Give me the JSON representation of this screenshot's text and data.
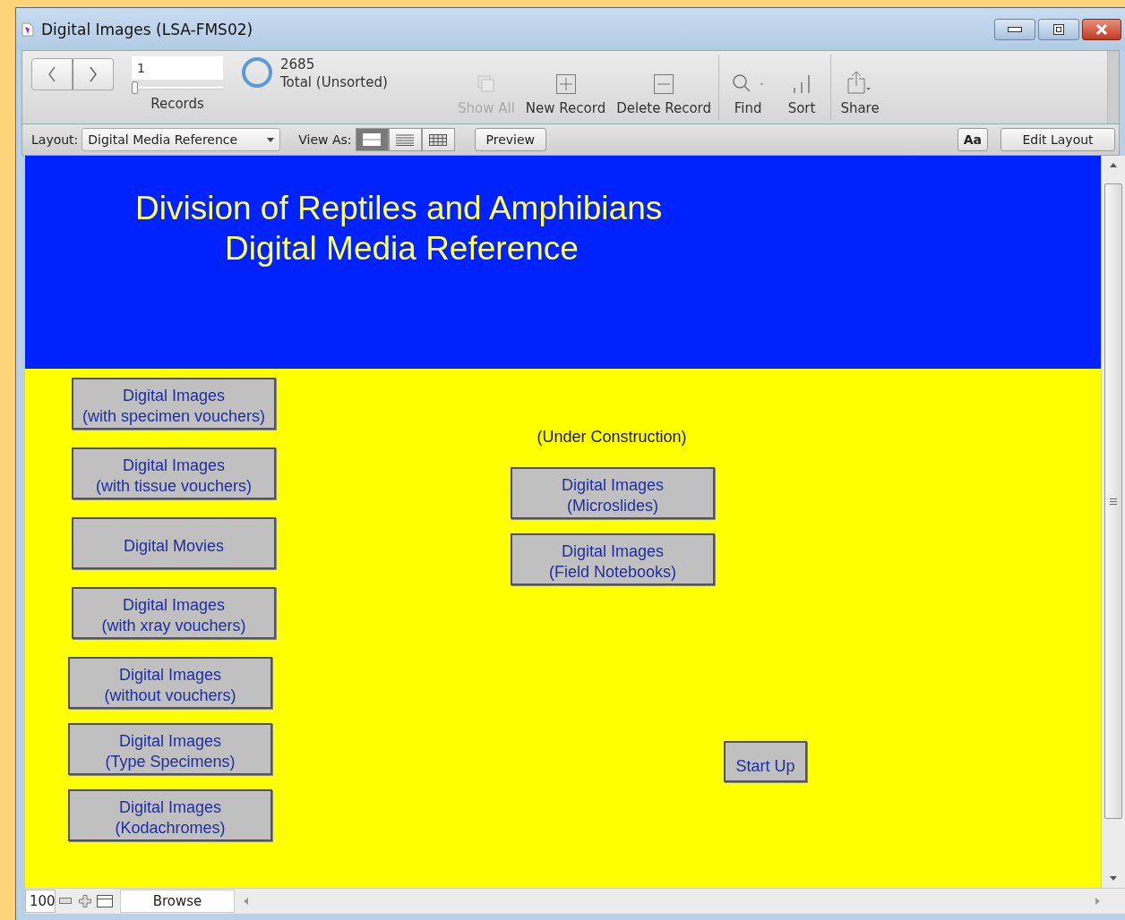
{
  "window": {
    "title": "Digital Images (LSA-FMS02)"
  },
  "toolbar": {
    "record_field": {
      "value": "1"
    },
    "record_slider": {
      "level": 0
    },
    "records_label": "Records",
    "total": "2685",
    "total_label": "Total (Unsorted)",
    "tools": [
      {
        "kind": "showall",
        "label": "Show All",
        "disabled": true
      },
      {
        "kind": "new",
        "label": "New Record",
        "disabled": false
      },
      {
        "kind": "delete",
        "label": "Delete Record",
        "disabled": false
      },
      {
        "kind": "find",
        "label": "Find",
        "disabled": false
      },
      {
        "kind": "sort",
        "label": "Sort",
        "disabled": false
      },
      {
        "kind": "share",
        "label": "Share",
        "disabled": false
      }
    ]
  },
  "layout_bar": {
    "layout_label": "Layout:",
    "layout": "Digital Media Reference",
    "view_label": "View As:",
    "views": [
      {
        "kind": "form",
        "selected": true
      },
      {
        "kind": "list",
        "selected": false
      },
      {
        "kind": "table",
        "selected": false
      }
    ],
    "preview": "Preview",
    "format_button": "Aa",
    "edit_layout": "Edit Layout"
  },
  "content": {
    "header": [
      "Division of Reptiles and Amphibians",
      "Digital Media Reference"
    ],
    "buttons": [
      {
        "label": "Digital Images\n(with specimen vouchers)"
      },
      {
        "label": "Digital Images\n(with tissue vouchers)"
      },
      {
        "label": "Digital Movies"
      },
      {
        "label": "Digital Images\n(with xray vouchers)"
      },
      {
        "label": "Digital Images\n(without vouchers)"
      },
      {
        "label": "Digital Images\n(Type Specimens)"
      },
      {
        "label": "Digital Images\n(Kodachromes)"
      },
      {
        "label": "Digital Images\n(Microslides)"
      },
      {
        "label": "Digital Images\n(Field Notebooks)"
      },
      {
        "label": "Start Up"
      }
    ],
    "note": "(Under Construction)"
  },
  "status_bar": {
    "zoom": "100",
    "mode": "Browse"
  }
}
